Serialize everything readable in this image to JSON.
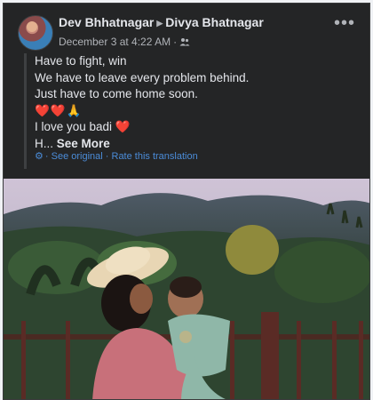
{
  "post": {
    "author": "Dev Bhhatnagar",
    "target": "Divya Bhatnagar",
    "timestamp": "December 3 at 4:22 AM",
    "separator": "·",
    "audience_icon": "friends-icon",
    "more_icon": "more-options-icon",
    "text_lines": [
      "Have to fight, win",
      "We have to leave every problem behind.",
      "Just have to come home soon.",
      "❤️❤️🙏",
      "I love you badi ❤️",
      "H..."
    ],
    "see_more": "See More",
    "see_original": "See original",
    "rate_translation": "Rate this translation",
    "translation_sep": "·"
  },
  "colors": {
    "card": "#242526",
    "text": "#e4e6eb",
    "secondary": "#b0b3b8",
    "link": "#4b8cd8"
  }
}
